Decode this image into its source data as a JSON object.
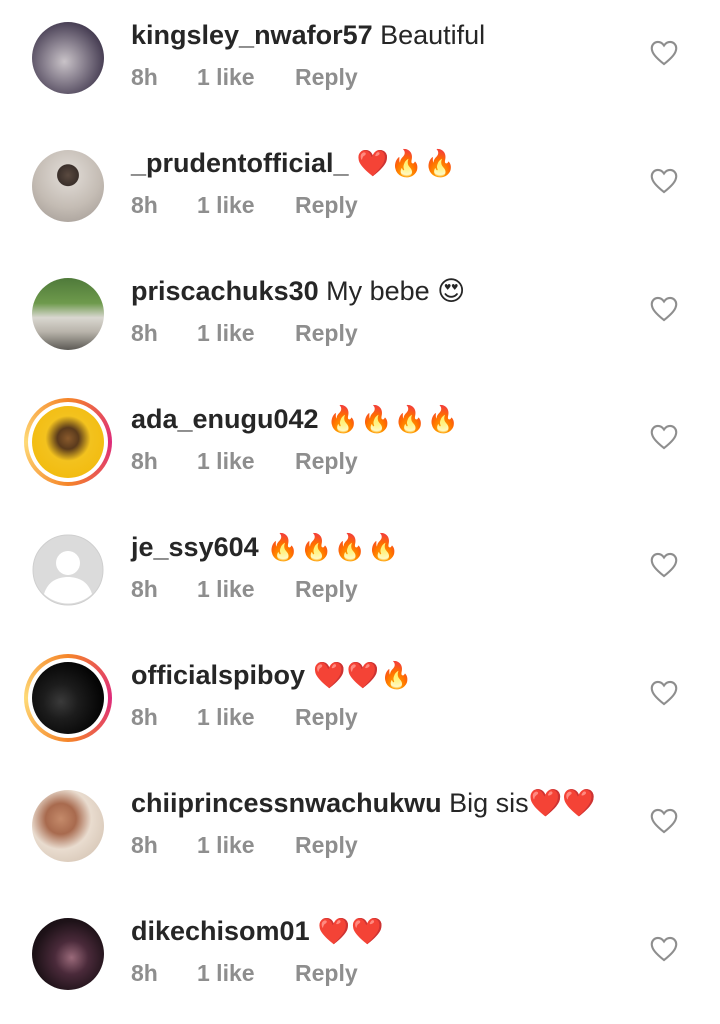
{
  "comments": [
    {
      "username": "kingsley_nwafor57",
      "text": " Beautiful",
      "time": "8h",
      "likes": "1 like",
      "reply": "Reply",
      "avatar": "photo-gray",
      "story": false
    },
    {
      "username": "_prudentofficial_",
      "text": " ❤️🔥🔥",
      "time": "8h",
      "likes": "1 like",
      "reply": "Reply",
      "avatar": "photo-man",
      "story": false
    },
    {
      "username": "priscachuks30",
      "text": " My bebe 😍",
      "time": "8h",
      "likes": "1 like",
      "reply": "Reply",
      "avatar": "photo-car",
      "story": false
    },
    {
      "username": "ada_enugu042",
      "text": " 🔥🔥🔥🔥",
      "time": "8h",
      "likes": "1 like",
      "reply": "Reply",
      "avatar": "photo-yellow",
      "story": true
    },
    {
      "username": "je_ssy604",
      "text": " 🔥🔥🔥🔥",
      "time": "8h",
      "likes": "1 like",
      "reply": "Reply",
      "avatar": "default-user",
      "story": false
    },
    {
      "username": "officialspiboy",
      "text": " ❤️❤️🔥",
      "time": "8h",
      "likes": "1 like",
      "reply": "Reply",
      "avatar": "photo-dark",
      "story": true
    },
    {
      "username": "chiiprincessnwachukwu",
      "text": " Big sis❤️❤️",
      "time": "8h",
      "likes": "1 like",
      "reply": "Reply",
      "avatar": "photo-woman",
      "story": false
    },
    {
      "username": "dikechisom01",
      "text": " ❤️❤️",
      "time": "8h",
      "likes": "1 like",
      "reply": "Reply",
      "avatar": "photo-girl",
      "story": false
    }
  ],
  "icons": {
    "like": "heart-outline-icon"
  }
}
